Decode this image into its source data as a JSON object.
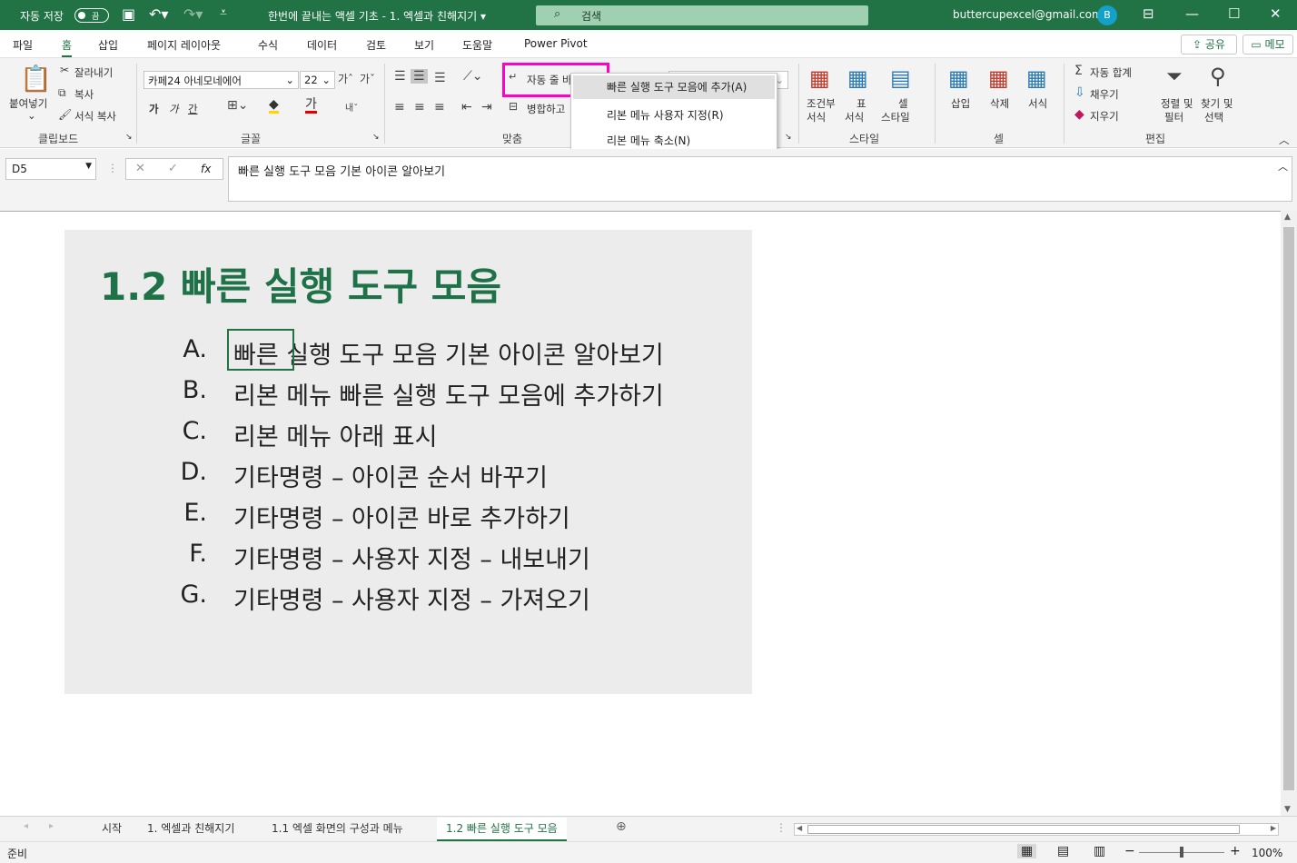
{
  "titlebar": {
    "autosave_label": "자동 저장",
    "autosave_state": "끔",
    "doc_title": "한번에 끝내는 액셀 기초 - 1. 엑셀과 친해지기 ▾",
    "search_placeholder": "검색",
    "account_email": "buttercupexcel@gmail.com",
    "avatar_letter": "B"
  },
  "menu_tabs": [
    "파일",
    "홈",
    "삽입",
    "페이지 레이아웃",
    "수식",
    "데이터",
    "검토",
    "보기",
    "도움말",
    "Power Pivot"
  ],
  "share_label": "공유",
  "memo_label": "메모",
  "ribbon": {
    "clipboard": {
      "paste": "붙여넣기",
      "cut": "잘라내기",
      "copy": "복사",
      "format_painter": "서식 복사",
      "group": "클립보드"
    },
    "font": {
      "name": "카페24 아네모네에어",
      "size": "22",
      "bold": "가",
      "italic": "가",
      "underline": "간",
      "group": "글꼴"
    },
    "alignment": {
      "wrap": "자동 줄 바꿈",
      "merge": "병합하고",
      "group": "맞춤"
    },
    "styles": {
      "conditional": "조건부",
      "conditional2": "서식",
      "table": "표",
      "table2": "서식",
      "cell": "셀",
      "cell2": "스타일",
      "group": "스타일"
    },
    "cells": {
      "insert": "삽입",
      "delete": "삭제",
      "format": "서식",
      "group": "셀"
    },
    "editing": {
      "autosum": "자동 합계",
      "fill": "채우기",
      "clear": "지우기",
      "sort": "정렬 및",
      "sort2": "필터",
      "find": "찾기 및",
      "find2": "선택",
      "group": "편집"
    }
  },
  "context_menu": [
    "빠른 실행 도구 모음에 추가(A)",
    "리본 메뉴 사용자 지정(R)",
    "리본 메뉴 축소(N)"
  ],
  "formula_bar": {
    "namebox": "D5",
    "content": "빠른 실행 도구 모음 기본 아이콘 알아보기"
  },
  "sheet": {
    "heading": "1.2 빠른 실행 도구 모음",
    "items": [
      {
        "letter": "A.",
        "text": "빠른 실행 도구 모음 기본 아이콘 알아보기"
      },
      {
        "letter": "B.",
        "text": "리본 메뉴 빠른 실행 도구 모음에 추가하기"
      },
      {
        "letter": "C.",
        "text": "리본 메뉴 아래 표시"
      },
      {
        "letter": "D.",
        "text": "기타명령 – 아이콘 순서 바꾸기"
      },
      {
        "letter": "E.",
        "text": "기타명령 – 아이콘 바로 추가하기"
      },
      {
        "letter": "F.",
        "text": "기타명령 – 사용자 지정 – 내보내기"
      },
      {
        "letter": "G.",
        "text": "기타명령 – 사용자 지정 – 가져오기"
      }
    ]
  },
  "sheet_tabs": [
    "시작",
    "1. 엑셀과 친해지기",
    "1.1 엑셀 화면의 구성과 메뉴",
    "1.2 빠른 실행 도구 모음"
  ],
  "status": {
    "ready": "준비",
    "zoom": "100%"
  },
  "colors": {
    "brand": "#217346",
    "heading": "#1f7148",
    "highlight": "#ff00cc"
  }
}
